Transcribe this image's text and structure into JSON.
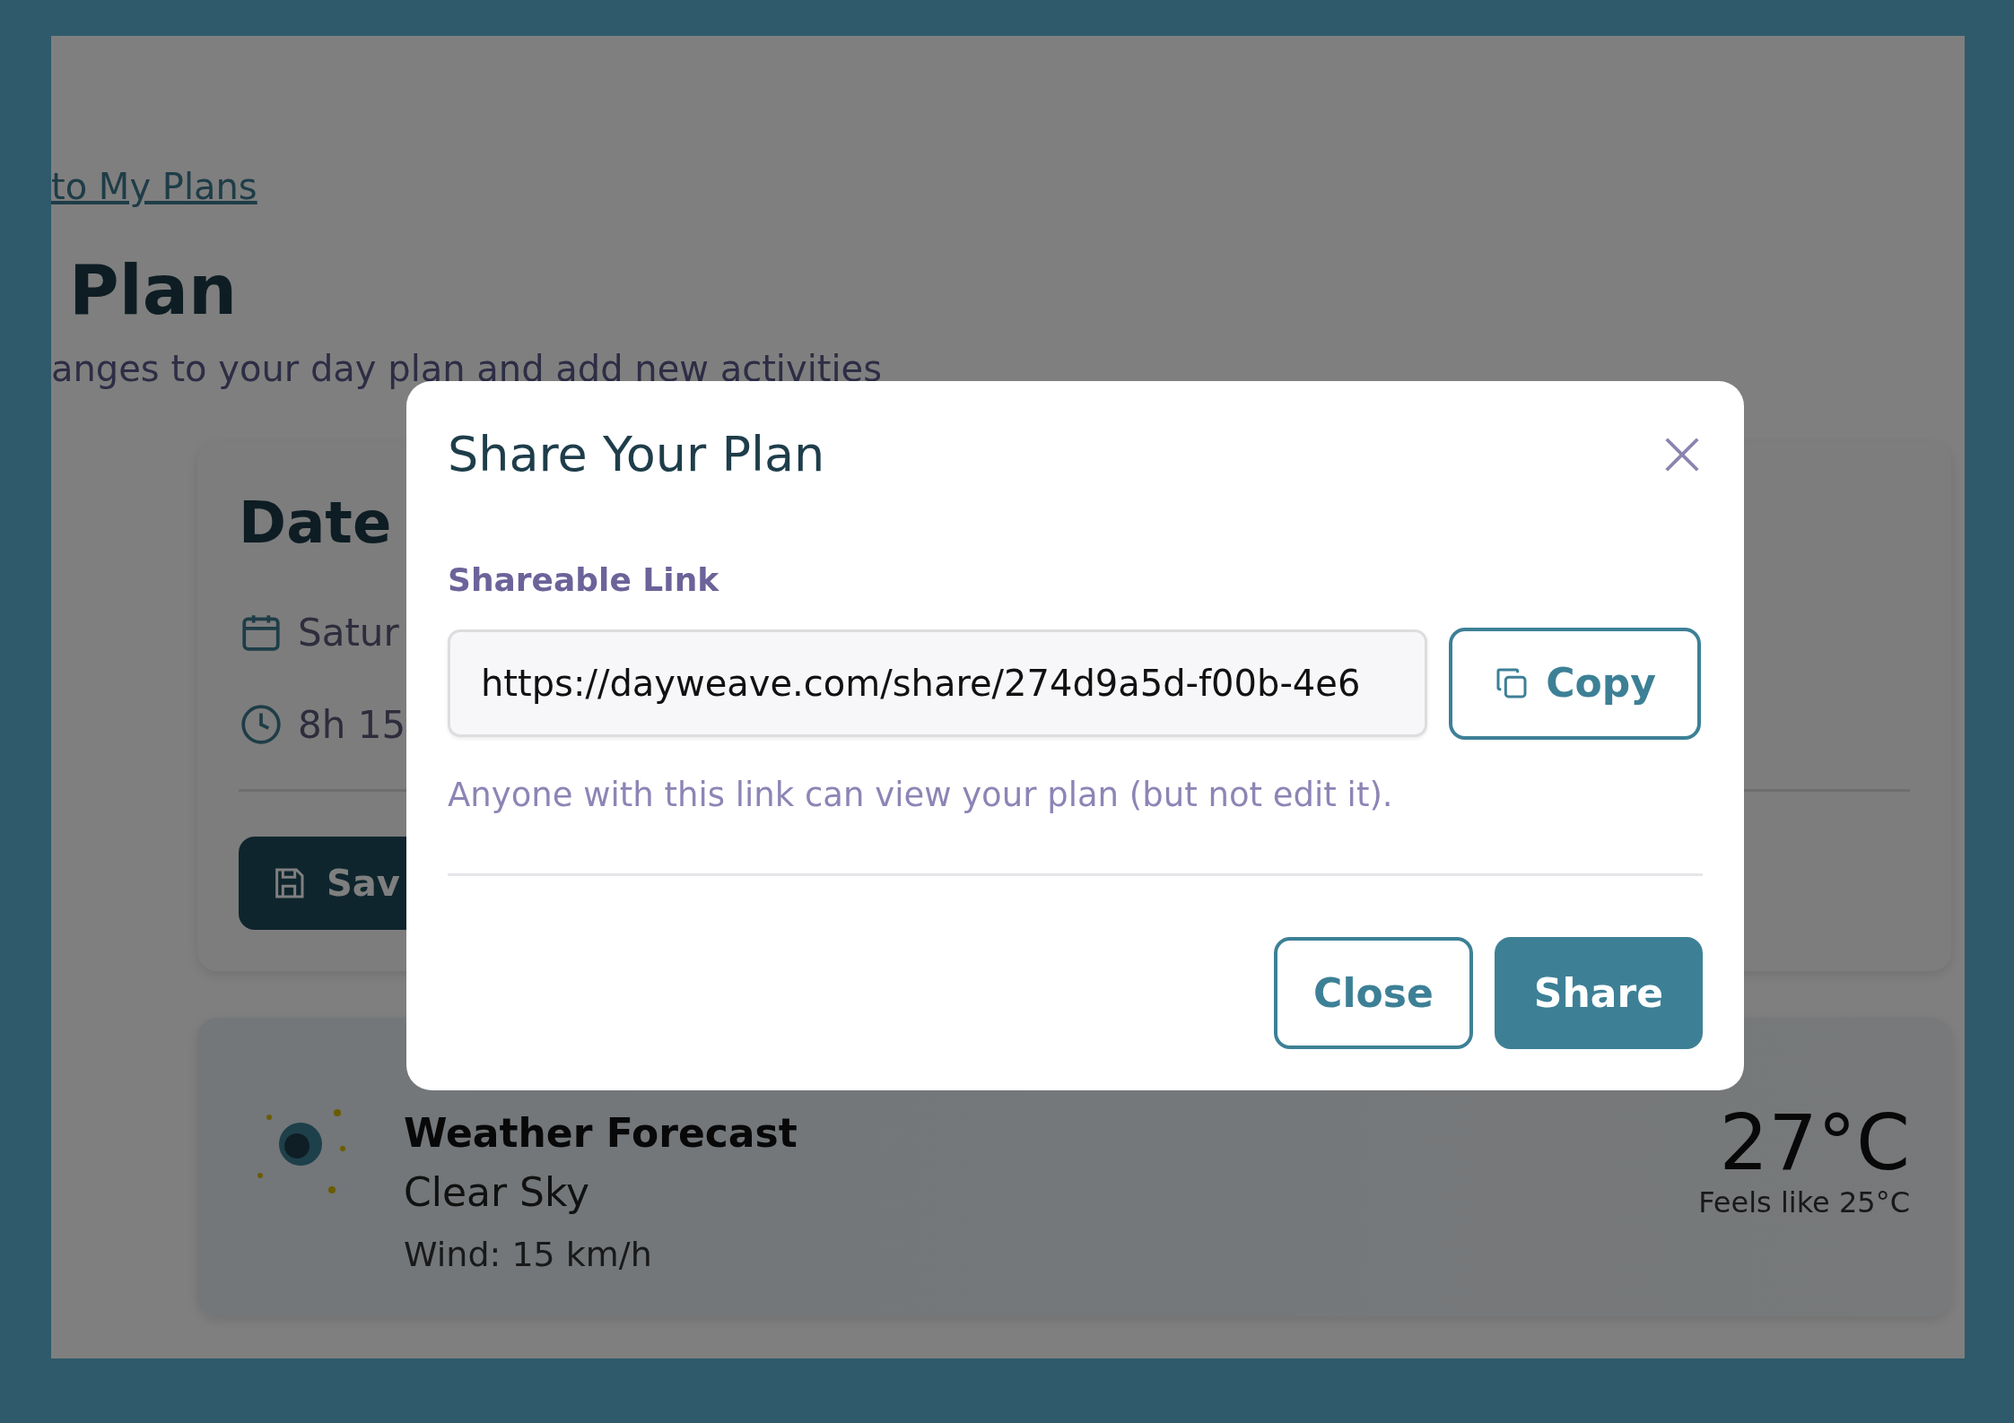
{
  "page": {
    "back_link": "to My Plans",
    "title": "Plan",
    "subtitle": "anges to your day plan and add new activities",
    "plan_card": {
      "title": "Date",
      "date": "Satur",
      "duration": "8h 15",
      "save_button": "Sav"
    },
    "weather": {
      "title": "Weather Forecast",
      "condition": "Clear Sky",
      "wind": "Wind: 15 km/h",
      "temperature": "27°C",
      "feels_like": "Feels like 25°C"
    }
  },
  "modal": {
    "title": "Share Your Plan",
    "field_label": "Shareable Link",
    "link_value": "https://dayweave.com/share/274d9a5d-f00b-4e6",
    "copy_button": "Copy",
    "hint": "Anyone with this link can view your plan (but not edit it).",
    "buttons": [
      {
        "label": "Close",
        "kind": "secondary"
      },
      {
        "label": "Share",
        "kind": "primary"
      }
    ]
  }
}
